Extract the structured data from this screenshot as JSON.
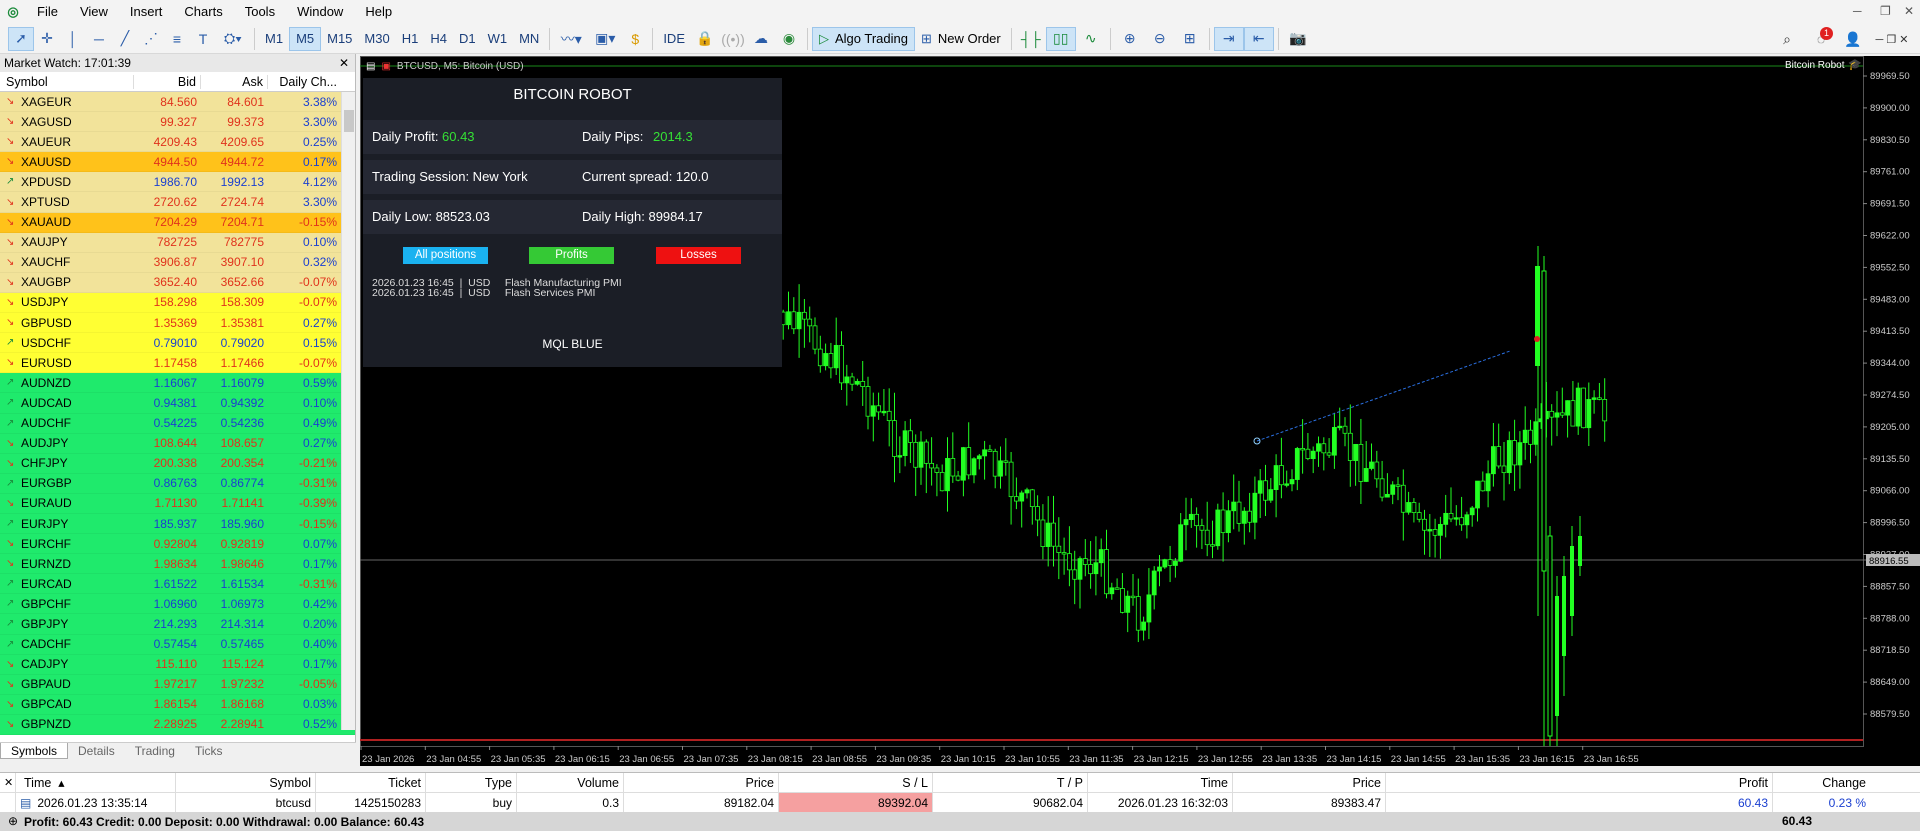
{
  "menu": {
    "items": [
      "File",
      "View",
      "Insert",
      "Charts",
      "Tools",
      "Window",
      "Help"
    ]
  },
  "toolbar": {
    "timeframes": [
      "M1",
      "M5",
      "M15",
      "M30",
      "H1",
      "H4",
      "D1",
      "W1",
      "MN"
    ],
    "selected_timeframe": "M5",
    "ide_label": "IDE",
    "algo_label": "Algo Trading",
    "order_label": "New Order",
    "notify_count": "1"
  },
  "market_watch": {
    "title": "Market Watch: 17:01:39",
    "columns": [
      "Symbol",
      "Bid",
      "Ask",
      "Daily Ch..."
    ],
    "rows": [
      {
        "s": "XAGEUR",
        "bid": "84.560",
        "ask": "84.601",
        "ch": "3.38%",
        "dir": "down",
        "bg": "#f2e39a",
        "pc": "#e0321c",
        "cc": "#1a3fd0"
      },
      {
        "s": "XAGUSD",
        "bid": "99.327",
        "ask": "99.373",
        "ch": "3.30%",
        "dir": "down",
        "bg": "#f2e39a",
        "pc": "#e0321c",
        "cc": "#1a3fd0"
      },
      {
        "s": "XAUEUR",
        "bid": "4209.43",
        "ask": "4209.65",
        "ch": "0.25%",
        "dir": "down",
        "bg": "#f2e39a",
        "pc": "#e0321c",
        "cc": "#1a3fd0"
      },
      {
        "s": "XAUUSD",
        "bid": "4944.50",
        "ask": "4944.72",
        "ch": "0.17%",
        "dir": "down",
        "bg": "#ffc21a",
        "pc": "#e0321c",
        "cc": "#1a3fd0"
      },
      {
        "s": "XPDUSD",
        "bid": "1986.70",
        "ask": "1992.13",
        "ch": "4.12%",
        "dir": "up",
        "bg": "#f2e39a",
        "pc": "#1a3fd0",
        "cc": "#1a3fd0"
      },
      {
        "s": "XPTUSD",
        "bid": "2720.62",
        "ask": "2724.74",
        "ch": "3.30%",
        "dir": "down",
        "bg": "#f2e39a",
        "pc": "#e0321c",
        "cc": "#1a3fd0"
      },
      {
        "s": "XAUAUD",
        "bid": "7204.29",
        "ask": "7204.71",
        "ch": "-0.15%",
        "dir": "down",
        "bg": "#ffc21a",
        "pc": "#e0321c",
        "cc": "#e0321c"
      },
      {
        "s": "XAUJPY",
        "bid": "782725",
        "ask": "782775",
        "ch": "0.10%",
        "dir": "down",
        "bg": "#f2e39a",
        "pc": "#e0321c",
        "cc": "#1a3fd0"
      },
      {
        "s": "XAUCHF",
        "bid": "3906.87",
        "ask": "3907.10",
        "ch": "0.32%",
        "dir": "down",
        "bg": "#f2e39a",
        "pc": "#e0321c",
        "cc": "#1a3fd0"
      },
      {
        "s": "XAUGBP",
        "bid": "3652.40",
        "ask": "3652.66",
        "ch": "-0.07%",
        "dir": "down",
        "bg": "#f2e39a",
        "pc": "#e0321c",
        "cc": "#e0321c"
      },
      {
        "s": "USDJPY",
        "bid": "158.298",
        "ask": "158.309",
        "ch": "-0.07%",
        "dir": "down",
        "bg": "#ffff33",
        "pc": "#e0321c",
        "cc": "#e0321c"
      },
      {
        "s": "GBPUSD",
        "bid": "1.35369",
        "ask": "1.35381",
        "ch": "0.27%",
        "dir": "down",
        "bg": "#ffff33",
        "pc": "#e0321c",
        "cc": "#1a3fd0"
      },
      {
        "s": "USDCHF",
        "bid": "0.79010",
        "ask": "0.79020",
        "ch": "0.15%",
        "dir": "up",
        "bg": "#ffff33",
        "pc": "#1a3fd0",
        "cc": "#1a3fd0"
      },
      {
        "s": "EURUSD",
        "bid": "1.17458",
        "ask": "1.17466",
        "ch": "-0.07%",
        "dir": "down",
        "bg": "#ffff33",
        "pc": "#e0321c",
        "cc": "#e0321c"
      },
      {
        "s": "AUDNZD",
        "bid": "1.16067",
        "ask": "1.16079",
        "ch": "0.59%",
        "dir": "up",
        "bg": "#1fea6c",
        "pc": "#1a3fd0",
        "cc": "#1a3fd0"
      },
      {
        "s": "AUDCAD",
        "bid": "0.94381",
        "ask": "0.94392",
        "ch": "0.10%",
        "dir": "up",
        "bg": "#1fea6c",
        "pc": "#1a3fd0",
        "cc": "#1a3fd0"
      },
      {
        "s": "AUDCHF",
        "bid": "0.54225",
        "ask": "0.54236",
        "ch": "0.49%",
        "dir": "up",
        "bg": "#1fea6c",
        "pc": "#1a3fd0",
        "cc": "#1a3fd0"
      },
      {
        "s": "AUDJPY",
        "bid": "108.644",
        "ask": "108.657",
        "ch": "0.27%",
        "dir": "down",
        "bg": "#1fea6c",
        "pc": "#e0321c",
        "cc": "#1a3fd0"
      },
      {
        "s": "CHFJPY",
        "bid": "200.338",
        "ask": "200.354",
        "ch": "-0.21%",
        "dir": "down",
        "bg": "#1fea6c",
        "pc": "#e0321c",
        "cc": "#e0321c"
      },
      {
        "s": "EURGBP",
        "bid": "0.86763",
        "ask": "0.86774",
        "ch": "-0.31%",
        "dir": "up",
        "bg": "#1fea6c",
        "pc": "#1a3fd0",
        "cc": "#e0321c"
      },
      {
        "s": "EURAUD",
        "bid": "1.71130",
        "ask": "1.71141",
        "ch": "-0.39%",
        "dir": "down",
        "bg": "#1fea6c",
        "pc": "#e0321c",
        "cc": "#e0321c"
      },
      {
        "s": "EURJPY",
        "bid": "185.937",
        "ask": "185.960",
        "ch": "-0.15%",
        "dir": "up",
        "bg": "#1fea6c",
        "pc": "#1a3fd0",
        "cc": "#e0321c"
      },
      {
        "s": "EURCHF",
        "bid": "0.92804",
        "ask": "0.92819",
        "ch": "0.07%",
        "dir": "down",
        "bg": "#1fea6c",
        "pc": "#e0321c",
        "cc": "#1a3fd0"
      },
      {
        "s": "EURNZD",
        "bid": "1.98634",
        "ask": "1.98646",
        "ch": "0.17%",
        "dir": "down",
        "bg": "#1fea6c",
        "pc": "#e0321c",
        "cc": "#1a3fd0"
      },
      {
        "s": "EURCAD",
        "bid": "1.61522",
        "ask": "1.61534",
        "ch": "-0.31%",
        "dir": "up",
        "bg": "#1fea6c",
        "pc": "#1a3fd0",
        "cc": "#e0321c"
      },
      {
        "s": "GBPCHF",
        "bid": "1.06960",
        "ask": "1.06973",
        "ch": "0.42%",
        "dir": "up",
        "bg": "#1fea6c",
        "pc": "#1a3fd0",
        "cc": "#1a3fd0"
      },
      {
        "s": "GBPJPY",
        "bid": "214.293",
        "ask": "214.314",
        "ch": "0.20%",
        "dir": "up",
        "bg": "#1fea6c",
        "pc": "#1a3fd0",
        "cc": "#1a3fd0"
      },
      {
        "s": "CADCHF",
        "bid": "0.57454",
        "ask": "0.57465",
        "ch": "0.40%",
        "dir": "up",
        "bg": "#1fea6c",
        "pc": "#1a3fd0",
        "cc": "#1a3fd0"
      },
      {
        "s": "CADJPY",
        "bid": "115.110",
        "ask": "115.124",
        "ch": "0.17%",
        "dir": "down",
        "bg": "#1fea6c",
        "pc": "#e0321c",
        "cc": "#1a3fd0"
      },
      {
        "s": "GBPAUD",
        "bid": "1.97217",
        "ask": "1.97232",
        "ch": "-0.05%",
        "dir": "down",
        "bg": "#1fea6c",
        "pc": "#e0321c",
        "cc": "#e0321c"
      },
      {
        "s": "GBPCAD",
        "bid": "1.86154",
        "ask": "1.86168",
        "ch": "0.03%",
        "dir": "down",
        "bg": "#1fea6c",
        "pc": "#e0321c",
        "cc": "#1a3fd0"
      },
      {
        "s": "GBPNZD",
        "bid": "2.28925",
        "ask": "2.28941",
        "ch": "0.52%",
        "dir": "down",
        "bg": "#1fea6c",
        "pc": "#e0321c",
        "cc": "#1a3fd0"
      }
    ],
    "tabs": [
      "Symbols",
      "Details",
      "Trading",
      "Ticks"
    ]
  },
  "chart": {
    "title": "BTCUSD, M5:  Bitcoin (USD)",
    "indicator_label": "Bitcoin Robot",
    "price_labels": [
      "89969.50",
      "89900.00",
      "89830.50",
      "89761.00",
      "89691.50",
      "89622.00",
      "89552.50",
      "89483.00",
      "89413.50",
      "89344.00",
      "89274.50",
      "89205.00",
      "89135.50",
      "89066.00",
      "88996.50",
      "88927.00",
      "88857.50",
      "88788.00",
      "88718.50",
      "88649.00",
      "88579.50"
    ],
    "current_price": "88916.55",
    "time_labels": [
      "23 Jan 2026",
      "23 Jan 04:55",
      "23 Jan 05:35",
      "23 Jan 06:15",
      "23 Jan 06:55",
      "23 Jan 07:35",
      "23 Jan 08:15",
      "23 Jan 08:55",
      "23 Jan 09:35",
      "23 Jan 10:15",
      "23 Jan 10:55",
      "23 Jan 11:35",
      "23 Jan 12:15",
      "23 Jan 12:55",
      "23 Jan 13:35",
      "23 Jan 14:15",
      "23 Jan 14:55",
      "23 Jan 15:35",
      "23 Jan 16:15",
      "23 Jan 16:55"
    ],
    "colors": {
      "bull": "#22ff22",
      "bear": "#000000",
      "wick": "#22ff22"
    }
  },
  "robot_panel": {
    "title": "BITCOIN ROBOT",
    "daily_profit_label": "Daily Profit:",
    "daily_profit_value": "60.43",
    "daily_pips_label": "Daily Pips:",
    "daily_pips_value": "2014.3",
    "session": "Trading Session: New York",
    "spread": "Current spread: 120.0",
    "daily_low": "Daily Low: 88523.03",
    "daily_high": "Daily High: 89984.17",
    "btn_all": "All positions",
    "btn_profits": "Profits",
    "btn_losses": "Losses",
    "news": [
      {
        "date": "2026.01.23 16:45",
        "cur": "USD",
        "event": "Flash Manufacturing PMI"
      },
      {
        "date": "2026.01.23 16:45",
        "cur": "USD",
        "event": "Flash Services PMI"
      }
    ],
    "footer": "MQL BLUE",
    "colors": {
      "green": "#35e135",
      "blue": "#1ab2f0",
      "red": "#ee1111"
    }
  },
  "terminal": {
    "columns": {
      "time": "Time",
      "symbol": "Symbol",
      "ticket": "Ticket",
      "type": "Type",
      "volume": "Volume",
      "price": "Price",
      "sl": "S / L",
      "tp": "T / P",
      "time2": "Time",
      "price2": "Price",
      "profit": "Profit",
      "change": "Change"
    },
    "row": {
      "time": "2026.01.23 13:35:14",
      "symbol": "btcusd",
      "ticket": "1425150283",
      "type": "buy",
      "volume": "0.3",
      "price": "89182.04",
      "sl": "89392.04",
      "tp": "90682.04",
      "time2": "2026.01.23 16:32:03",
      "price2": "89383.47",
      "profit": "60.43",
      "change": "0.23 %"
    },
    "footer": "Profit: 60.43  Credit: 0.00  Deposit: 0.00  Withdrawal: 0.00  Balance: 60.43",
    "footer_total": "60.43"
  }
}
